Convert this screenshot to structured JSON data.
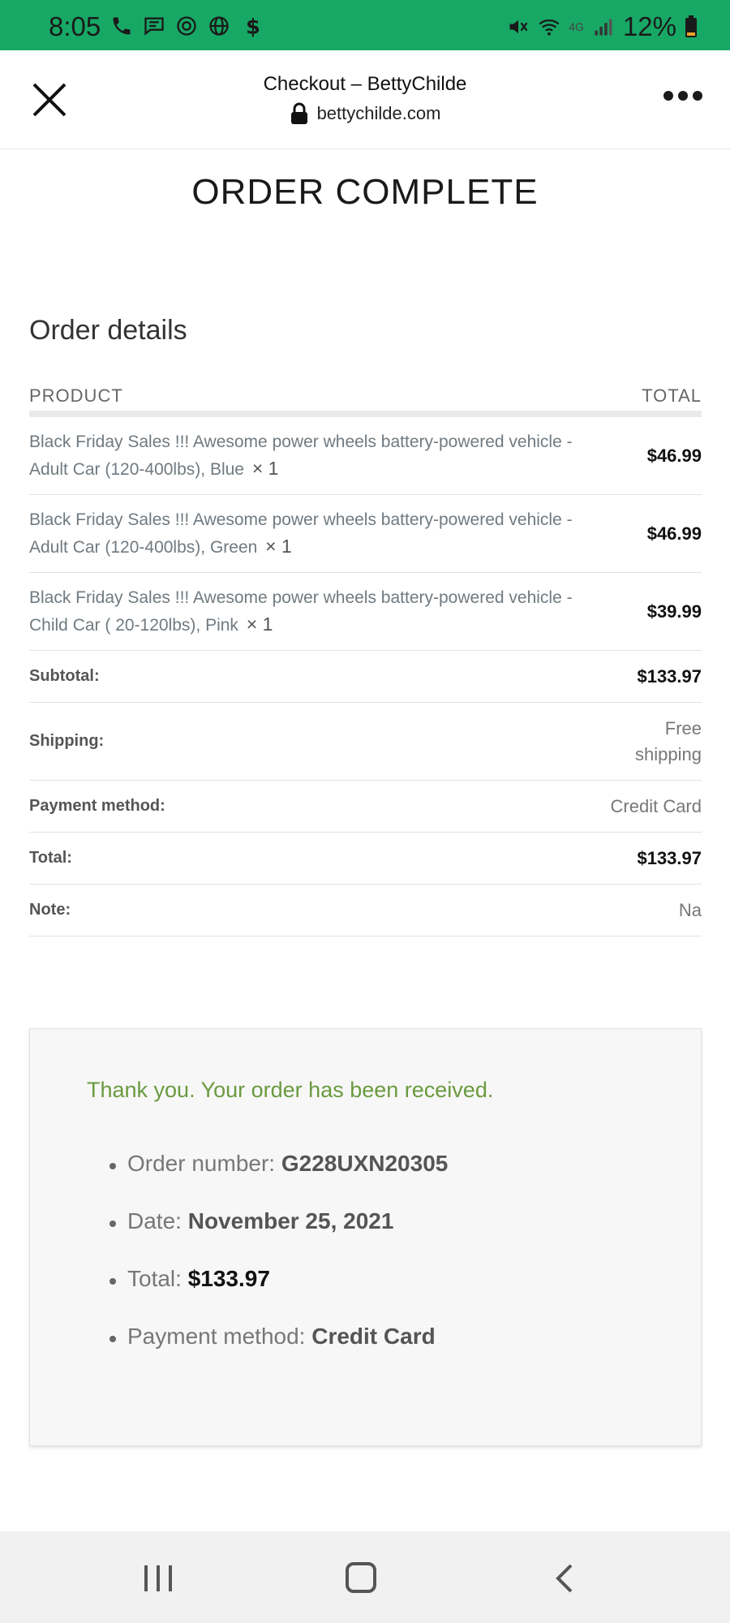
{
  "status_bar": {
    "time": "8:05",
    "battery": "12%",
    "network": "4G"
  },
  "browser": {
    "title": "Checkout – BettyChilde",
    "url": "bettychilde.com"
  },
  "page": {
    "title": "ORDER COMPLETE"
  },
  "order_details": {
    "heading": "Order details",
    "col_product": "PRODUCT",
    "col_total": "TOTAL",
    "items": [
      {
        "name": "Black Friday Sales !!! Awesome power wheels battery-powered vehicle - Adult Car (120-400lbs), Blue",
        "qty": "× 1",
        "total": "$46.99"
      },
      {
        "name": "Black Friday Sales !!! Awesome power wheels battery-powered vehicle - Adult Car (120-400lbs), Green",
        "qty": "× 1",
        "total": "$46.99"
      },
      {
        "name": "Black Friday Sales !!! Awesome power wheels battery-powered vehicle - Child Car ( 20-120lbs), Pink",
        "qty": "× 1",
        "total": "$39.99"
      }
    ],
    "subtotal_label": "Subtotal:",
    "subtotal_value": "$133.97",
    "shipping_label": "Shipping:",
    "shipping_value": "Free shipping",
    "payment_label": "Payment method:",
    "payment_value": "Credit Card",
    "total_label": "Total:",
    "total_value": "$133.97",
    "note_label": "Note:",
    "note_value": "Na"
  },
  "thanks": {
    "message": "Thank you. Your order has been received.",
    "order_number_label": "Order number:",
    "order_number": "G228UXN20305",
    "date_label": "Date:",
    "date": "November 25, 2021",
    "total_label": "Total:",
    "total": "$133.97",
    "payment_label": "Payment method:",
    "payment": "Credit Card"
  },
  "colors": {
    "status_bar": "#17a865",
    "thanks_text": "#6a9a3f"
  }
}
